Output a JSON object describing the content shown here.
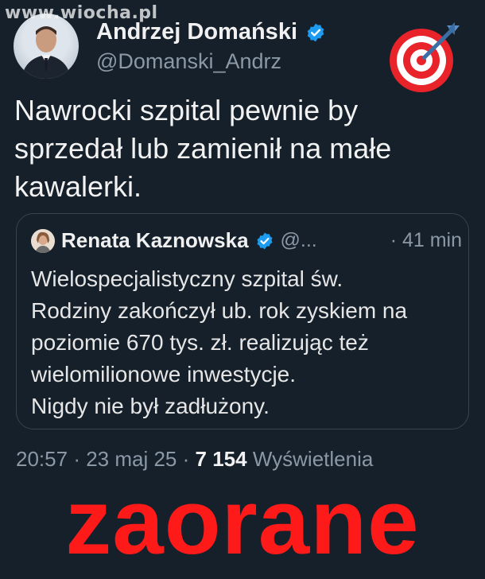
{
  "watermark": "www.wiocha.pl",
  "author": {
    "name": "Andrzej Domański",
    "handle": "@Domanski_Andrz",
    "verified_icon": "verified-badge-icon",
    "emoji": "direct-hit-target-icon"
  },
  "tweet": {
    "text": "Nawrocki szpital pewnie by sprzedał lub zamienił na małe kawalerki."
  },
  "quoted": {
    "name": "Renata Kaznowska",
    "handle": "@...",
    "time": "· 41 min",
    "lines": [
      "Wielospecjalistyczny szpital św.",
      "Rodziny zakończył ub. rok zyskiem na",
      "poziomie 670 tys. zł. realizując też",
      "wielomilionowe inwestycje.",
      "Nigdy nie był zadłużony."
    ]
  },
  "meta": {
    "time": "20:57",
    "date": "23 maj 25",
    "views": "7 154",
    "views_label": "Wyświetlenia"
  },
  "caption": "zaorane",
  "colors": {
    "background": "#15202b",
    "verified": "#1d9bf0",
    "caption": "#ff1a1a"
  }
}
